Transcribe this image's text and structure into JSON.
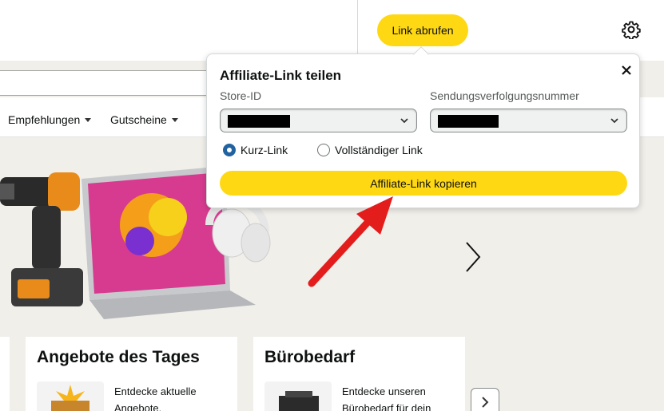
{
  "toolbar": {
    "get_link_label": "Link abrufen",
    "settings_icon": "gear-icon"
  },
  "nav": {
    "items": [
      {
        "label": "Empfehlungen"
      },
      {
        "label": "Gutscheine"
      }
    ]
  },
  "popup": {
    "title": "Affiliate-Link teilen",
    "close_icon": "close-icon",
    "store_id_label": "Store-ID",
    "tracking_label": "Sendungsverfolgungsnummer",
    "radio_short": "Kurz-Link",
    "radio_full": "Vollständiger Link",
    "selected_option": "Kurz-Link",
    "copy_label": "Affiliate-Link kopieren"
  },
  "cards": [
    {
      "title": "Angebote des Tages",
      "desc": "Entdecke aktuelle Angebote."
    },
    {
      "title": "Bürobedarf",
      "desc": "Entdecke unseren Bürobedarf für dein"
    }
  ],
  "colors": {
    "accent_yellow": "#ffd814",
    "radio_blue": "#2162a1",
    "annotation_red": "#e31c1c",
    "page_bg": "#f1efea"
  }
}
